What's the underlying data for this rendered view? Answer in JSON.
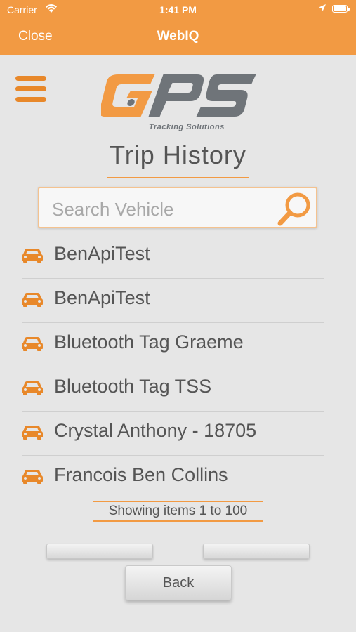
{
  "status_bar": {
    "carrier": "Carrier",
    "time": "1:41 PM"
  },
  "nav": {
    "close_label": "Close",
    "title": "WebIQ"
  },
  "logo": {
    "wordmark": "GPS",
    "tagline": "Tracking Solutions"
  },
  "page": {
    "title": "Trip History"
  },
  "search": {
    "placeholder": "Search Vehicle",
    "value": ""
  },
  "vehicles": [
    {
      "name": "BenApiTest"
    },
    {
      "name": "BenApiTest"
    },
    {
      "name": "Bluetooth Tag Graeme"
    },
    {
      "name": "Bluetooth Tag TSS"
    },
    {
      "name": "Crystal Anthony - 18705"
    },
    {
      "name": "Francois Ben Collins"
    }
  ],
  "paging": {
    "text": "Showing items 1 to 100",
    "prev_label": "",
    "next_label": ""
  },
  "back_button": {
    "label": "Back"
  },
  "colors": {
    "accent": "#f29a43",
    "icon": "#e8882a",
    "logo_grey": "#6f7479",
    "text": "#555555",
    "background": "#e6e6e6"
  }
}
